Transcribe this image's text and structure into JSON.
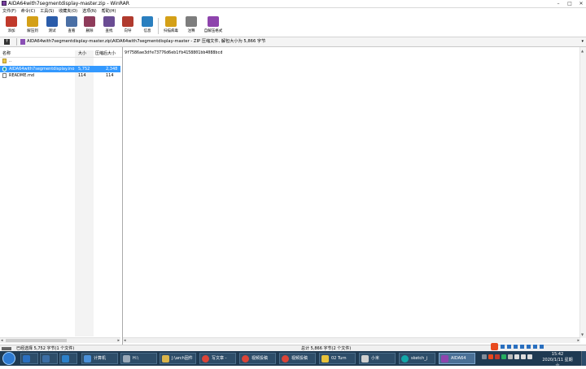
{
  "window": {
    "title": "AIDA64with7segmentdisplay-master.zip - WinRAR",
    "minimize": "–",
    "maximize": "□",
    "close": "✕"
  },
  "menu": [
    "文件(F)",
    "命令(C)",
    "工具(S)",
    "收藏夹(O)",
    "选项(N)",
    "帮助(H)"
  ],
  "toolbar": [
    {
      "label": "添加",
      "color": "#c0392b"
    },
    {
      "label": "解压到",
      "color": "#d4a017"
    },
    {
      "label": "测试",
      "color": "#2a5caa"
    },
    {
      "label": "查看",
      "color": "#4a6fa5"
    },
    {
      "label": "删除",
      "color": "#8e3b5a"
    },
    {
      "label": "查找",
      "color": "#6a4c93"
    },
    {
      "label": "向导",
      "color": "#b03a2e"
    },
    {
      "label": "信息",
      "color": "#2a7fbf"
    },
    {
      "label": "扫描病毒",
      "color": "#d4a017"
    },
    {
      "label": "注释",
      "color": "#7d7d7d"
    },
    {
      "label": "自解压格式",
      "color": "#8e44ad"
    }
  ],
  "address": {
    "up_icon": "up-arrow-icon",
    "path": "AIDA64with7segmentdisplay-master.zip\\AIDA64with7segmentdisplay-master - ZIP 压缩文件, 解包大小为 5,866 字节",
    "dropdown": "▾"
  },
  "file_list": {
    "headers": {
      "name": "名称",
      "size": "大小",
      "packed": "压缩后大小"
    },
    "rows": [
      {
        "name": "..",
        "size": "",
        "packed": "",
        "selected": false,
        "icon": "folder-icon"
      },
      {
        "name": "AIDA64with7segmentdisplay.ino",
        "size": "5,752",
        "packed": "2,348",
        "selected": true,
        "icon": "ino-file-icon"
      },
      {
        "name": "README.md",
        "size": "114",
        "packed": "114",
        "selected": false,
        "icon": "text-file-icon"
      }
    ]
  },
  "preview": {
    "text": "9f7586ae3dfe73776d6eb1fb4158801bb4088bcd"
  },
  "status": {
    "left": "已经选择 5,752 字节(1 个文件)",
    "middle": "总计 5,866 字节(2 个文件)"
  },
  "taskbar": {
    "items": [
      {
        "label": "",
        "color": "#2a6fbf"
      },
      {
        "label": "",
        "color": "#3b6ea5"
      },
      {
        "label": "",
        "color": "#2c80c9"
      },
      {
        "label": "计算机",
        "color": "#4a90d9"
      },
      {
        "label": "H:\\",
        "color": "#9aa9b8"
      },
      {
        "label": "J:\\arch固件",
        "color": "#d9b44a"
      },
      {
        "label": "写文章 -",
        "color": "#db4437"
      },
      {
        "label": "视频投稿",
        "color": "#db4437"
      },
      {
        "label": "视频投稿",
        "color": "#db4437"
      },
      {
        "label": "02 Turn",
        "color": "#e8c23a"
      },
      {
        "label": "小米",
        "color": "#cfcfcf"
      },
      {
        "label": "sketch_j",
        "color": "#12a7a8"
      },
      {
        "label": "AIDA64",
        "color": "#8e44ad"
      }
    ],
    "clock_time": "15:42",
    "clock_date": "2020/1/11 星期六"
  }
}
